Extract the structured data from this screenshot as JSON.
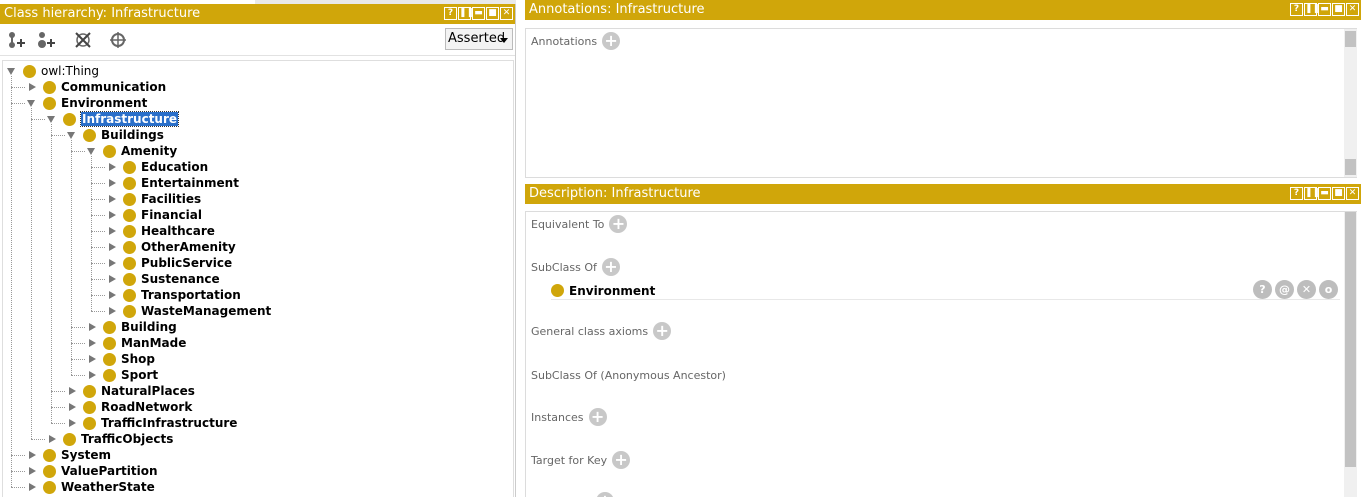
{
  "left_panel": {
    "title": "Class hierarchy: Infrastructure",
    "win_buttons": [
      "?",
      "❚❚",
      "▬",
      "■",
      "✕"
    ],
    "dropdown_value": "Asserted",
    "toolbar_icons": [
      "add-subclass-icon",
      "add-sibling-icon",
      "delete-class-icon",
      "target-icon"
    ]
  },
  "tree": [
    {
      "label": "owl:Thing",
      "depth": 0,
      "state": "open",
      "plain": true
    },
    {
      "label": "Communication",
      "depth": 1,
      "state": "closed"
    },
    {
      "label": "Environment",
      "depth": 1,
      "state": "open"
    },
    {
      "label": "Infrastructure",
      "depth": 2,
      "state": "open",
      "selected": true
    },
    {
      "label": "Buildings",
      "depth": 3,
      "state": "open"
    },
    {
      "label": "Amenity",
      "depth": 4,
      "state": "open"
    },
    {
      "label": "Education",
      "depth": 5,
      "state": "closed"
    },
    {
      "label": "Entertainment",
      "depth": 5,
      "state": "closed"
    },
    {
      "label": "Facilities",
      "depth": 5,
      "state": "closed"
    },
    {
      "label": "Financial",
      "depth": 5,
      "state": "closed"
    },
    {
      "label": "Healthcare",
      "depth": 5,
      "state": "closed"
    },
    {
      "label": "OtherAmenity",
      "depth": 5,
      "state": "closed"
    },
    {
      "label": "PublicService",
      "depth": 5,
      "state": "closed"
    },
    {
      "label": "Sustenance",
      "depth": 5,
      "state": "closed"
    },
    {
      "label": "Transportation",
      "depth": 5,
      "state": "closed"
    },
    {
      "label": "WasteManagement",
      "depth": 5,
      "state": "closed"
    },
    {
      "label": "Building",
      "depth": 4,
      "state": "closed"
    },
    {
      "label": "ManMade",
      "depth": 4,
      "state": "closed"
    },
    {
      "label": "Shop",
      "depth": 4,
      "state": "closed"
    },
    {
      "label": "Sport",
      "depth": 4,
      "state": "closed"
    },
    {
      "label": "NaturalPlaces",
      "depth": 3,
      "state": "closed"
    },
    {
      "label": "RoadNetwork",
      "depth": 3,
      "state": "closed"
    },
    {
      "label": "TrafficInfrastructure",
      "depth": 3,
      "state": "closed"
    },
    {
      "label": "TrafficObjects",
      "depth": 2,
      "state": "closed"
    },
    {
      "label": "System",
      "depth": 1,
      "state": "closed"
    },
    {
      "label": "ValuePartition",
      "depth": 1,
      "state": "closed"
    },
    {
      "label": "WeatherState",
      "depth": 1,
      "state": "closed"
    }
  ],
  "annotations_panel": {
    "title": "Annotations: Infrastructure",
    "section_label": "Annotations"
  },
  "description_panel": {
    "title": "Description: Infrastructure",
    "sections": {
      "equivalent_to": "Equivalent To",
      "subclass_of": "SubClass Of",
      "general_axioms": "General class axioms",
      "anon_ancestor": "SubClass Of (Anonymous Ancestor)",
      "instances": "Instances",
      "target_for_key": "Target for Key"
    },
    "subclass_entry": "Environment",
    "entry_buttons": [
      "?",
      "@",
      "✕",
      "o"
    ]
  },
  "colors": {
    "accent": "#d0a60a",
    "selection": "#2a6fc9"
  }
}
